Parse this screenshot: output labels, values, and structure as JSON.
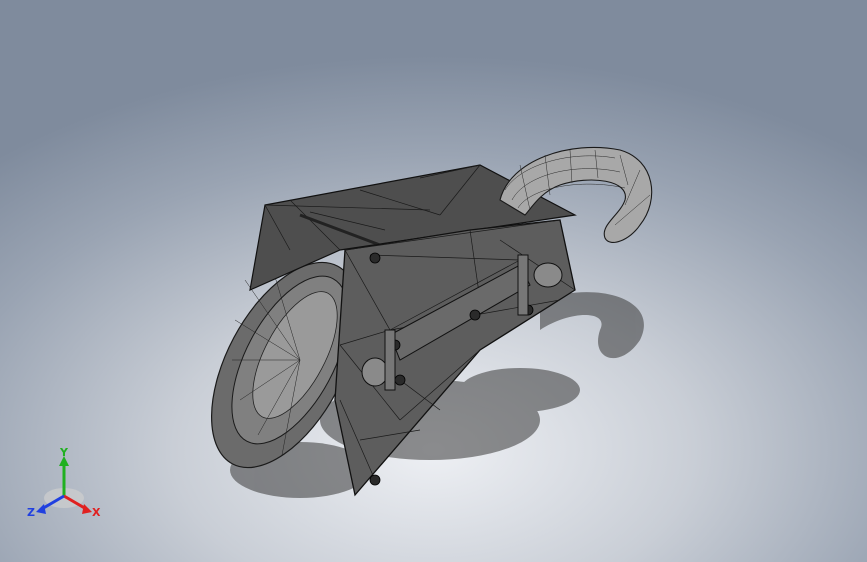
{
  "viewport": {
    "background_top": "#7f8b9d",
    "background_bottom": "#eef0f4",
    "model_fill": "#5a5a5a",
    "model_edge": "#1a1a1a"
  },
  "triad": {
    "x_label": "X",
    "y_label": "Y",
    "z_label": "Z",
    "x_color": "#e02020",
    "y_color": "#20b020",
    "z_color": "#2040e0"
  }
}
